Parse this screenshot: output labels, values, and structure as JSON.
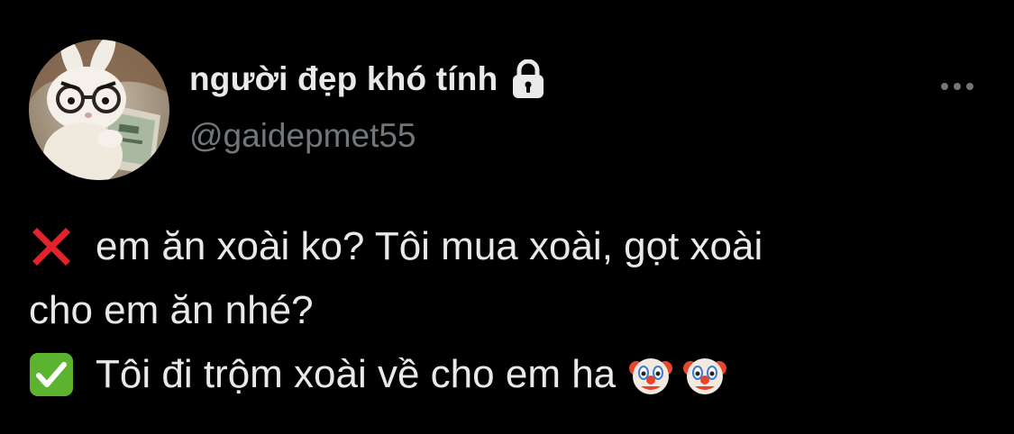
{
  "profile": {
    "display_name": "người đẹp khó tính",
    "handle": "@gaidepmet55",
    "avatar_icon": "bunny-with-glasses-reading-avatar",
    "lock_icon": "lock-icon",
    "more_icon": "more-options-icon"
  },
  "tweet": {
    "line1": "em ăn xoài ko? Tôi mua xoài, gọt xoài",
    "line2": "cho em ăn nhé?",
    "line3": "Tôi đi trộm xoài về cho em ha",
    "line1_emoji": "cross-mark-icon",
    "line3_emoji": "check-mark-button-icon",
    "trailing_emojis": [
      "clown-face-icon",
      "clown-face-icon"
    ]
  },
  "colors": {
    "background": "#000000",
    "primary_text": "#e7e9ea",
    "secondary_text": "#71767b",
    "cross_red": "#e1242b",
    "check_green": "#5cb330"
  }
}
